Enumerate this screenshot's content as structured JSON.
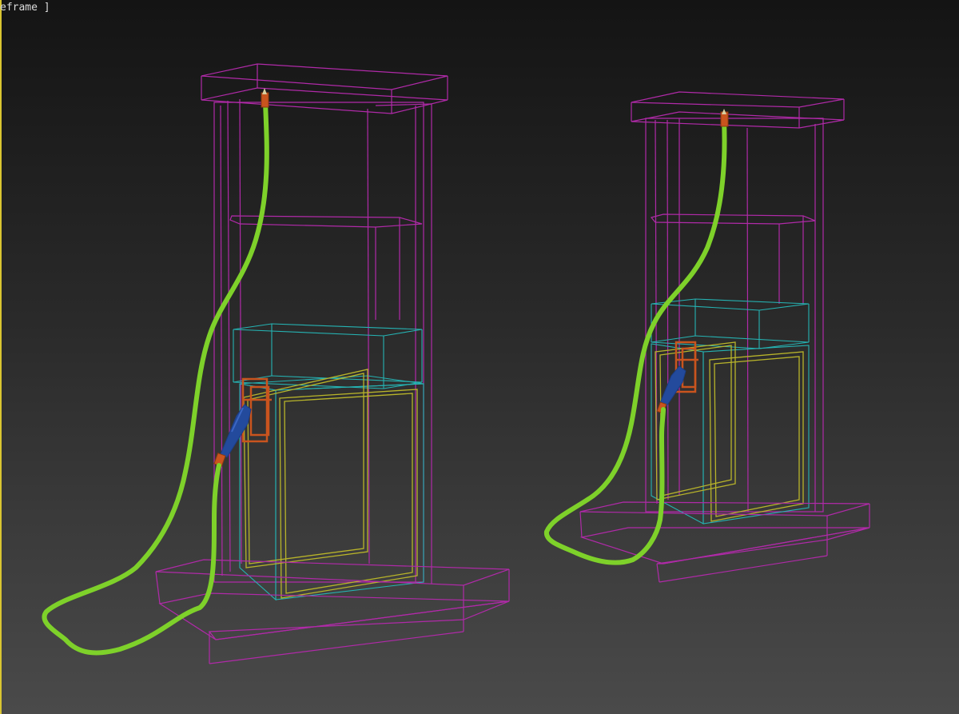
{
  "viewport": {
    "label": "eframe ]",
    "active_border_color": "#d9c531",
    "background_top": "#141414",
    "background_bottom": "#4a4a4a"
  },
  "scene": {
    "objects": [
      {
        "name": "fuel-pump-left",
        "display_mode": "wireframe"
      },
      {
        "name": "fuel-pump-right",
        "display_mode": "wireframe"
      }
    ],
    "colors": {
      "body_wire": "#b02aa8",
      "panel_wire": "#25b3b3",
      "screen_wire": "#b8b42a",
      "hose": "#7ed12a",
      "nozzle": "#234a9c",
      "holster": "#c9541e"
    }
  }
}
